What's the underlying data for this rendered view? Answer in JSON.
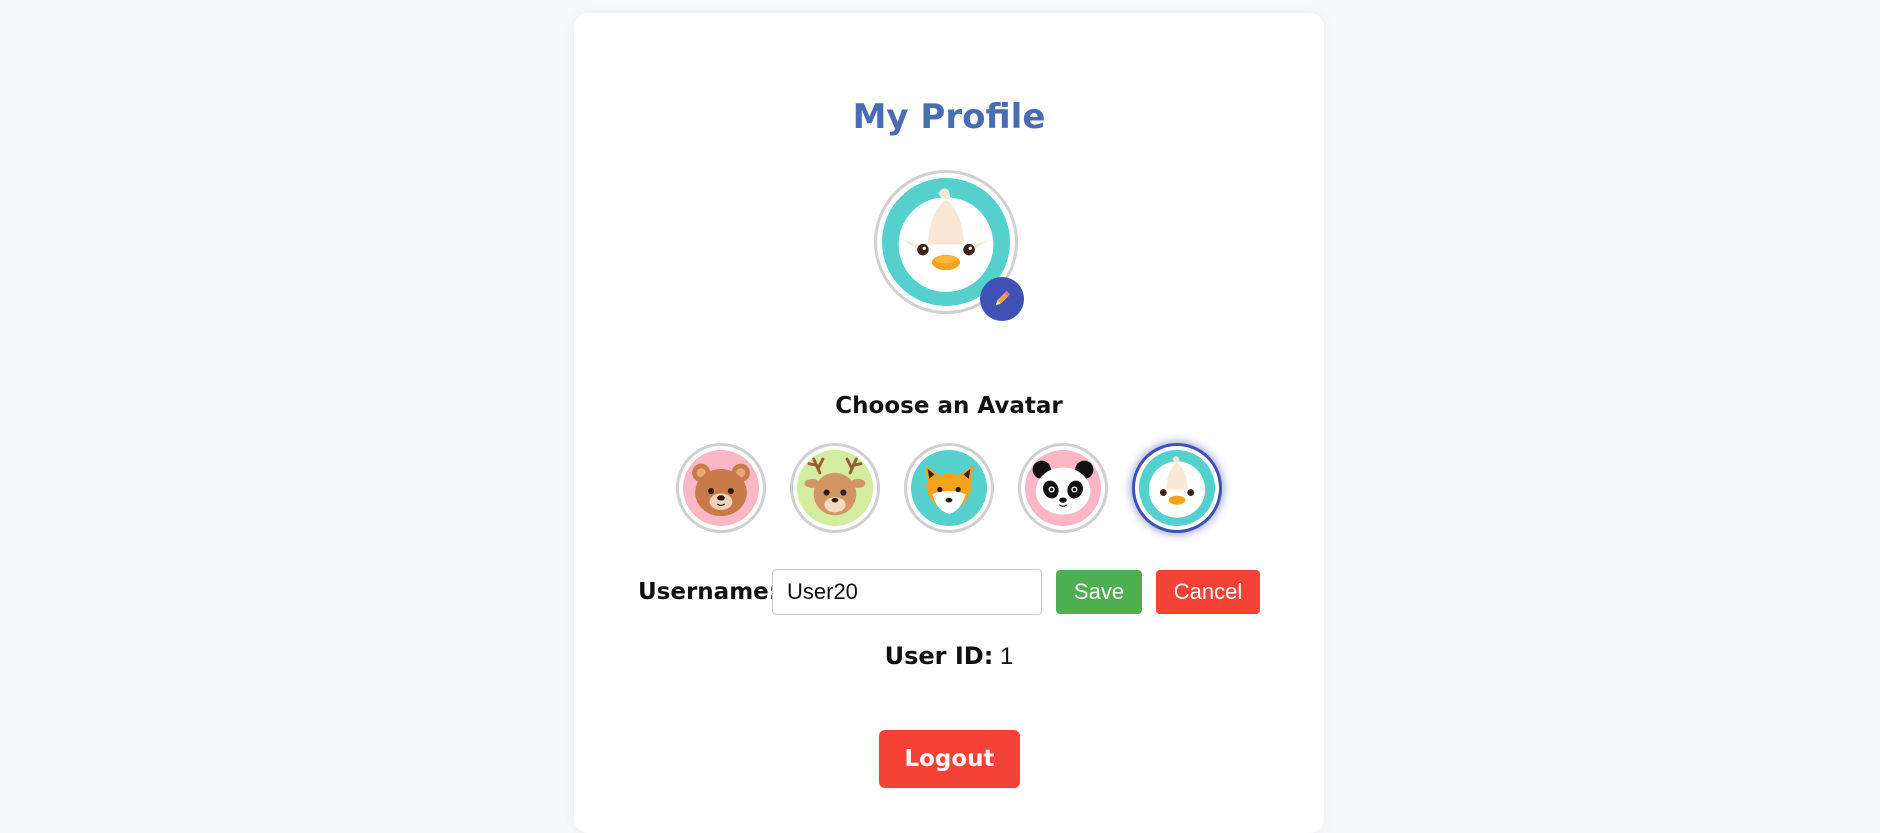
{
  "profile": {
    "title": "My Profile",
    "current_avatar": "duck-avatar",
    "edit_icon": "pencil-icon",
    "accent_color": "#3f51b5"
  },
  "avatar_picker": {
    "heading": "Choose an Avatar",
    "options": [
      {
        "name": "bear-avatar",
        "selected": false
      },
      {
        "name": "deer-avatar",
        "selected": false
      },
      {
        "name": "fox-avatar",
        "selected": false
      },
      {
        "name": "panda-avatar",
        "selected": false
      },
      {
        "name": "duck-avatar",
        "selected": true
      }
    ]
  },
  "username": {
    "label": "Username:",
    "value": "User20",
    "save_label": "Save",
    "cancel_label": "Cancel",
    "save_color": "#4caf50",
    "cancel_color": "#f44336"
  },
  "user_id": {
    "label": "User ID:",
    "value": "1"
  },
  "logout": {
    "label": "Logout",
    "color": "#f44336"
  }
}
